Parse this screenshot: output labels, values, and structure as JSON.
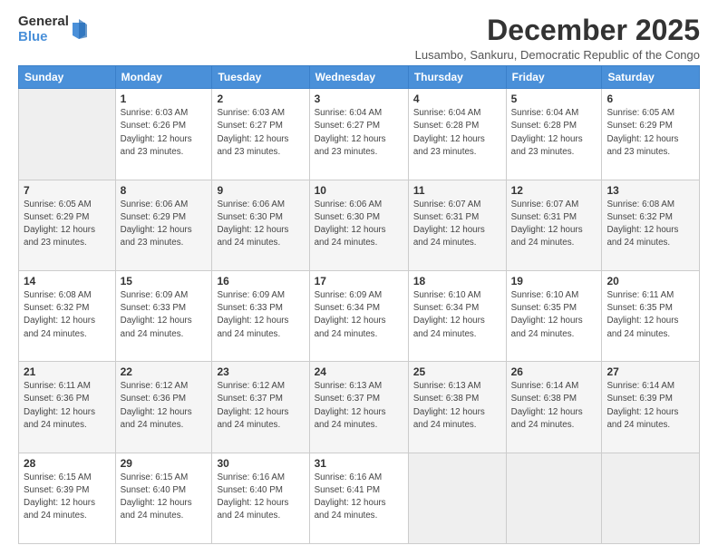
{
  "logo": {
    "general": "General",
    "blue": "Blue"
  },
  "title": "December 2025",
  "subtitle": "Lusambo, Sankuru, Democratic Republic of the Congo",
  "days_of_week": [
    "Sunday",
    "Monday",
    "Tuesday",
    "Wednesday",
    "Thursday",
    "Friday",
    "Saturday"
  ],
  "weeks": [
    [
      {
        "day": "",
        "info": ""
      },
      {
        "day": "1",
        "info": "Sunrise: 6:03 AM\nSunset: 6:26 PM\nDaylight: 12 hours\nand 23 minutes."
      },
      {
        "day": "2",
        "info": "Sunrise: 6:03 AM\nSunset: 6:27 PM\nDaylight: 12 hours\nand 23 minutes."
      },
      {
        "day": "3",
        "info": "Sunrise: 6:04 AM\nSunset: 6:27 PM\nDaylight: 12 hours\nand 23 minutes."
      },
      {
        "day": "4",
        "info": "Sunrise: 6:04 AM\nSunset: 6:28 PM\nDaylight: 12 hours\nand 23 minutes."
      },
      {
        "day": "5",
        "info": "Sunrise: 6:04 AM\nSunset: 6:28 PM\nDaylight: 12 hours\nand 23 minutes."
      },
      {
        "day": "6",
        "info": "Sunrise: 6:05 AM\nSunset: 6:29 PM\nDaylight: 12 hours\nand 23 minutes."
      }
    ],
    [
      {
        "day": "7",
        "info": "Sunrise: 6:05 AM\nSunset: 6:29 PM\nDaylight: 12 hours\nand 23 minutes."
      },
      {
        "day": "8",
        "info": "Sunrise: 6:06 AM\nSunset: 6:29 PM\nDaylight: 12 hours\nand 23 minutes."
      },
      {
        "day": "9",
        "info": "Sunrise: 6:06 AM\nSunset: 6:30 PM\nDaylight: 12 hours\nand 24 minutes."
      },
      {
        "day": "10",
        "info": "Sunrise: 6:06 AM\nSunset: 6:30 PM\nDaylight: 12 hours\nand 24 minutes."
      },
      {
        "day": "11",
        "info": "Sunrise: 6:07 AM\nSunset: 6:31 PM\nDaylight: 12 hours\nand 24 minutes."
      },
      {
        "day": "12",
        "info": "Sunrise: 6:07 AM\nSunset: 6:31 PM\nDaylight: 12 hours\nand 24 minutes."
      },
      {
        "day": "13",
        "info": "Sunrise: 6:08 AM\nSunset: 6:32 PM\nDaylight: 12 hours\nand 24 minutes."
      }
    ],
    [
      {
        "day": "14",
        "info": "Sunrise: 6:08 AM\nSunset: 6:32 PM\nDaylight: 12 hours\nand 24 minutes."
      },
      {
        "day": "15",
        "info": "Sunrise: 6:09 AM\nSunset: 6:33 PM\nDaylight: 12 hours\nand 24 minutes."
      },
      {
        "day": "16",
        "info": "Sunrise: 6:09 AM\nSunset: 6:33 PM\nDaylight: 12 hours\nand 24 minutes."
      },
      {
        "day": "17",
        "info": "Sunrise: 6:09 AM\nSunset: 6:34 PM\nDaylight: 12 hours\nand 24 minutes."
      },
      {
        "day": "18",
        "info": "Sunrise: 6:10 AM\nSunset: 6:34 PM\nDaylight: 12 hours\nand 24 minutes."
      },
      {
        "day": "19",
        "info": "Sunrise: 6:10 AM\nSunset: 6:35 PM\nDaylight: 12 hours\nand 24 minutes."
      },
      {
        "day": "20",
        "info": "Sunrise: 6:11 AM\nSunset: 6:35 PM\nDaylight: 12 hours\nand 24 minutes."
      }
    ],
    [
      {
        "day": "21",
        "info": "Sunrise: 6:11 AM\nSunset: 6:36 PM\nDaylight: 12 hours\nand 24 minutes."
      },
      {
        "day": "22",
        "info": "Sunrise: 6:12 AM\nSunset: 6:36 PM\nDaylight: 12 hours\nand 24 minutes."
      },
      {
        "day": "23",
        "info": "Sunrise: 6:12 AM\nSunset: 6:37 PM\nDaylight: 12 hours\nand 24 minutes."
      },
      {
        "day": "24",
        "info": "Sunrise: 6:13 AM\nSunset: 6:37 PM\nDaylight: 12 hours\nand 24 minutes."
      },
      {
        "day": "25",
        "info": "Sunrise: 6:13 AM\nSunset: 6:38 PM\nDaylight: 12 hours\nand 24 minutes."
      },
      {
        "day": "26",
        "info": "Sunrise: 6:14 AM\nSunset: 6:38 PM\nDaylight: 12 hours\nand 24 minutes."
      },
      {
        "day": "27",
        "info": "Sunrise: 6:14 AM\nSunset: 6:39 PM\nDaylight: 12 hours\nand 24 minutes."
      }
    ],
    [
      {
        "day": "28",
        "info": "Sunrise: 6:15 AM\nSunset: 6:39 PM\nDaylight: 12 hours\nand 24 minutes."
      },
      {
        "day": "29",
        "info": "Sunrise: 6:15 AM\nSunset: 6:40 PM\nDaylight: 12 hours\nand 24 minutes."
      },
      {
        "day": "30",
        "info": "Sunrise: 6:16 AM\nSunset: 6:40 PM\nDaylight: 12 hours\nand 24 minutes."
      },
      {
        "day": "31",
        "info": "Sunrise: 6:16 AM\nSunset: 6:41 PM\nDaylight: 12 hours\nand 24 minutes."
      },
      {
        "day": "",
        "info": ""
      },
      {
        "day": "",
        "info": ""
      },
      {
        "day": "",
        "info": ""
      }
    ]
  ]
}
